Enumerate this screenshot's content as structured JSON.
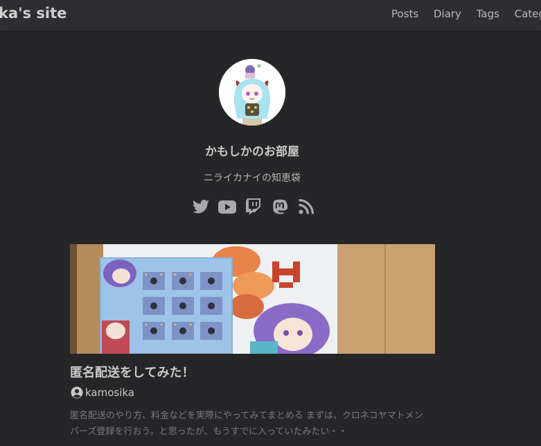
{
  "header": {
    "site_title": "ka's site",
    "nav": [
      "Posts",
      "Diary",
      "Tags",
      "Catego"
    ]
  },
  "profile": {
    "name": "かもしかのお部屋",
    "subtitle": "ニライカナイの知恵袋",
    "socials": [
      "twitter-icon",
      "youtube-icon",
      "twitch-icon",
      "mastodon-icon",
      "rss-icon"
    ]
  },
  "post": {
    "title": "匿名配送をしてみた！",
    "author": "kamosika",
    "excerpt_line1": "匿名配送のやり方、料金などを実際にやってみてまとめる まずは、クロネコヤマトメン",
    "excerpt_line2": "バーズ登録を行おう。と思ったが、もうすでに入っていたみたい・・"
  },
  "colors": {
    "background": "#262629",
    "header": "#2e2e32",
    "text": "#cfcfcf",
    "muted": "#7a7a7c"
  }
}
